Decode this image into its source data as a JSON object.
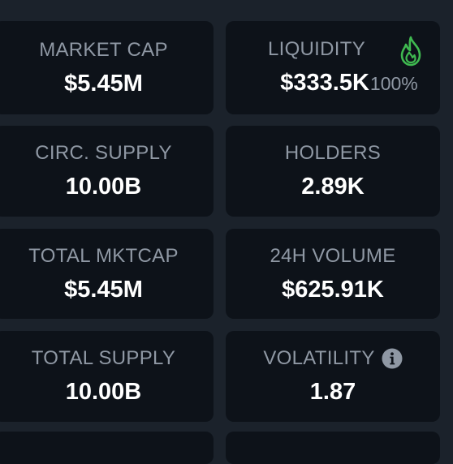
{
  "stats": [
    {
      "label": "MARKET CAP",
      "value": "$5.45M"
    },
    {
      "label": "LIQUIDITY",
      "value": "$333.5K",
      "extra": "100%"
    },
    {
      "label": "CIRC. SUPPLY",
      "value": "10.00B"
    },
    {
      "label": "HOLDERS",
      "value": "2.89K"
    },
    {
      "label": "TOTAL MKTCAP",
      "value": "$5.45M"
    },
    {
      "label": "24H VOLUME",
      "value": "$625.91K"
    },
    {
      "label": "TOTAL SUPPLY",
      "value": "10.00B"
    },
    {
      "label": "VOLATILITY",
      "value": "1.87"
    }
  ],
  "icons": {
    "liquidity": "flame-icon",
    "volatility": "info-icon"
  },
  "colors": {
    "background": "#1b222b",
    "card": "#0d1219",
    "label": "#8f98a4",
    "value": "#ffffff",
    "flame": "#3fb950",
    "info": "#8f98a4"
  }
}
